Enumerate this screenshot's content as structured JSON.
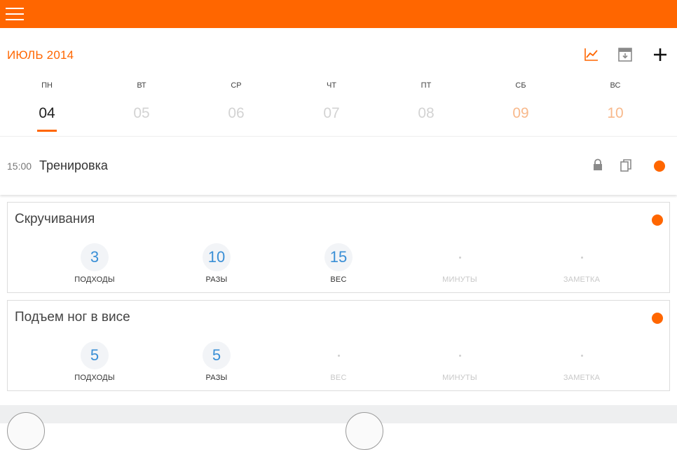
{
  "header": {
    "menu_icon": "hamburger-menu-icon",
    "bg_color": "#ff6600"
  },
  "calendar": {
    "month_title": "ИЮЛЬ 2014",
    "toolbar": {
      "chart_icon": "line-chart-icon",
      "archive_icon": "archive-box-icon",
      "add_icon": "plus-icon"
    },
    "days": [
      {
        "name": "ПН",
        "num": "04",
        "state": "selected"
      },
      {
        "name": "ВТ",
        "num": "05",
        "state": "normal"
      },
      {
        "name": "СР",
        "num": "06",
        "state": "normal"
      },
      {
        "name": "ЧТ",
        "num": "07",
        "state": "normal"
      },
      {
        "name": "ПТ",
        "num": "08",
        "state": "normal"
      },
      {
        "name": "СБ",
        "num": "09",
        "state": "weekend"
      },
      {
        "name": "ВС",
        "num": "10",
        "state": "weekend"
      }
    ],
    "accent": "#ff6600"
  },
  "workout": {
    "time": "15:00",
    "title": "Тренировка",
    "icons": [
      "lock-icon",
      "copy-icon"
    ],
    "status_color": "#ff6600"
  },
  "exercises": [
    {
      "title": "Скручивания",
      "stats": [
        {
          "value": "3",
          "label": "ПОДХОДЫ"
        },
        {
          "value": "10",
          "label": "РАЗЫ"
        },
        {
          "value": "15",
          "label": "ВЕС"
        },
        {
          "value": "",
          "label": "МИНУТЫ"
        },
        {
          "value": "",
          "label": "ЗАМЕТКА"
        }
      ]
    },
    {
      "title": "Подъем ног в висе",
      "stats": [
        {
          "value": "5",
          "label": "ПОДХОДЫ"
        },
        {
          "value": "5",
          "label": "РАЗЫ"
        },
        {
          "value": "",
          "label": "ВЕС"
        },
        {
          "value": "",
          "label": "МИНУТЫ"
        },
        {
          "value": "",
          "label": "ЗАМЕТКА"
        }
      ]
    }
  ]
}
